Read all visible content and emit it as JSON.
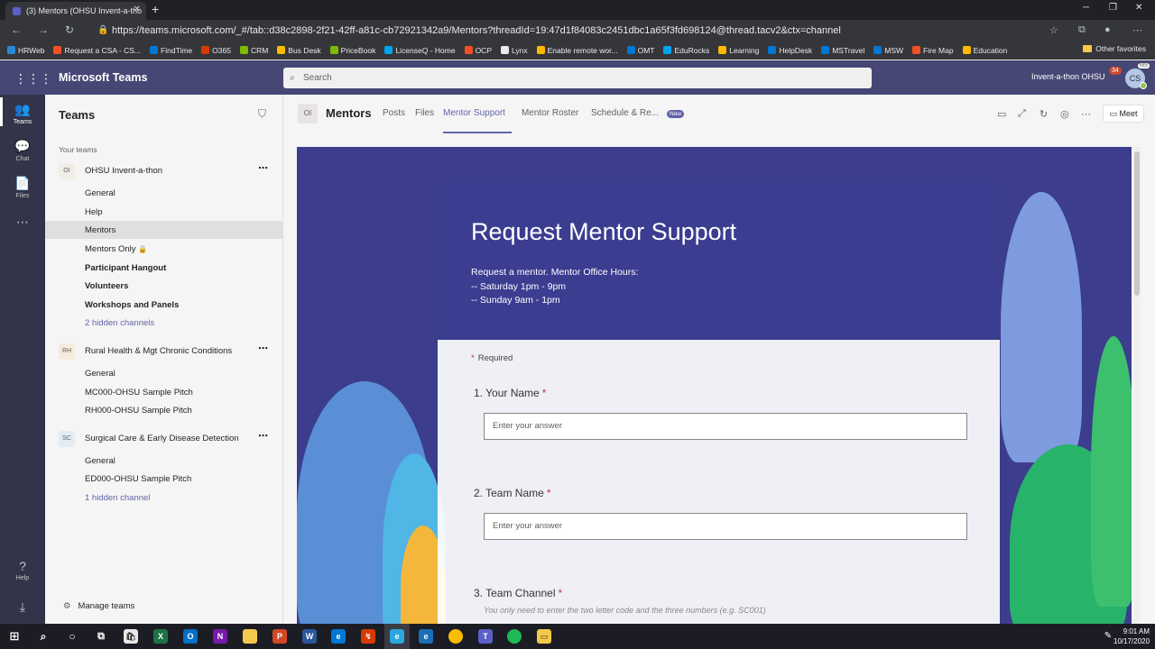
{
  "browser": {
    "tab_title": "(3) Mentors (OHSU Invent-a-tho",
    "url": "https://teams.microsoft.com/_#/tab::d38c2898-2f21-42ff-a81c-cb72921342a9/Mentors?threadId=19:47d1f84083c2451dbc1a65f3fd698124@thread.tacv2&ctx=channel",
    "bookmarks": [
      "HRWeb",
      "Request a CSA - CS...",
      "FindTime",
      "O365",
      "CRM",
      "Bus Desk",
      "PriceBook",
      "LicenseQ - Home",
      "OCP",
      "Lynx",
      "Enable remote wor...",
      "OMT",
      "EduRocks",
      "Learning",
      "HelpDesk",
      "MSTravel",
      "MSW",
      "Fire Map",
      "Education"
    ],
    "other_favorites": "Other favorites"
  },
  "teams_header": {
    "app_name": "Microsoft Teams",
    "search_placeholder": "Search",
    "org": "Invent-a-thon OHSU",
    "notification_count": "34",
    "avatar_initials": "CS",
    "ms_badge": "MS"
  },
  "rail": {
    "teams": "Teams",
    "chat": "Chat",
    "files": "Files",
    "help": "Help"
  },
  "teams_panel": {
    "title": "Teams",
    "your_teams": "Your teams",
    "manage": "Manage teams",
    "teams": [
      {
        "initials": "OI",
        "name": "OHSU Invent-a-thon",
        "channels": [
          "General",
          "Help",
          "Mentors",
          "Mentors Only",
          "Participant Hangout",
          "Volunteers",
          "Workshops and Panels",
          "2 hidden channels"
        ]
      },
      {
        "initials": "RH",
        "name": "Rural Health & Mgt Chronic Conditions",
        "channels": [
          "General",
          "MC000-OHSU Sample Pitch",
          "RH000-OHSU Sample Pitch"
        ]
      },
      {
        "initials": "SC",
        "name": "Surgical Care & Early Disease Detection",
        "channels": [
          "General",
          "ED000-OHSU Sample Pitch",
          "1 hidden channel"
        ]
      }
    ]
  },
  "channel_header": {
    "initials": "OI",
    "title": "Mentors",
    "tabs": [
      "Posts",
      "Files",
      "Mentor Support",
      "Mentor Roster",
      "Schedule & Re..."
    ],
    "new_badge": "New",
    "meet": "Meet"
  },
  "form": {
    "title": "Request Mentor Support",
    "description": "Request a mentor.  Mentor Office Hours:\n-- Saturday 1pm - 9pm\n-- Sunday 9am - 1pm",
    "required_note": "Required",
    "questions": [
      {
        "label": "1. Your Name",
        "placeholder": "Enter your answer"
      },
      {
        "label": "2. Team Name",
        "placeholder": "Enter your answer"
      },
      {
        "label": "3. Team Channel",
        "hint": "You only need to enter the two letter code and the three numbers (e.g. SC001)"
      }
    ]
  },
  "taskbar": {
    "time": "9:01 AM",
    "date": "10/17/2020"
  }
}
